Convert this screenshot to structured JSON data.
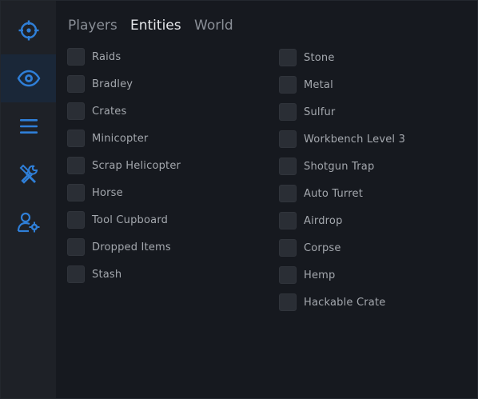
{
  "sidebar": {
    "items": [
      {
        "icon": "crosshair-icon",
        "active": false
      },
      {
        "icon": "eye-icon",
        "active": true
      },
      {
        "icon": "list-icon",
        "active": false
      },
      {
        "icon": "tools-icon",
        "active": false
      },
      {
        "icon": "user-settings-icon",
        "active": false
      }
    ],
    "accent": "#2f7fd8"
  },
  "tabs": [
    {
      "label": "Players",
      "active": false
    },
    {
      "label": "Entities",
      "active": true
    },
    {
      "label": "World",
      "active": false
    }
  ],
  "left_options": [
    {
      "label": "Raids",
      "checked": false
    },
    {
      "label": "Bradley",
      "checked": false
    },
    {
      "label": "Crates",
      "checked": false
    },
    {
      "label": "Minicopter",
      "checked": false
    },
    {
      "label": "Scrap Helicopter",
      "checked": false
    },
    {
      "label": "Horse",
      "checked": false
    },
    {
      "label": "Tool Cupboard",
      "checked": false
    },
    {
      "label": "Dropped Items",
      "checked": false
    },
    {
      "label": "Stash",
      "checked": false
    }
  ],
  "right_options": [
    {
      "label": "Stone",
      "checked": false
    },
    {
      "label": "Metal",
      "checked": false
    },
    {
      "label": "Sulfur",
      "checked": false
    },
    {
      "label": "Workbench Level 3",
      "checked": false
    },
    {
      "label": "Shotgun Trap",
      "checked": false
    },
    {
      "label": "Auto Turret",
      "checked": false
    },
    {
      "label": "Airdrop",
      "checked": false
    },
    {
      "label": "Corpse",
      "checked": false
    },
    {
      "label": "Hemp",
      "checked": false
    },
    {
      "label": "Hackable Crate",
      "checked": false
    }
  ]
}
